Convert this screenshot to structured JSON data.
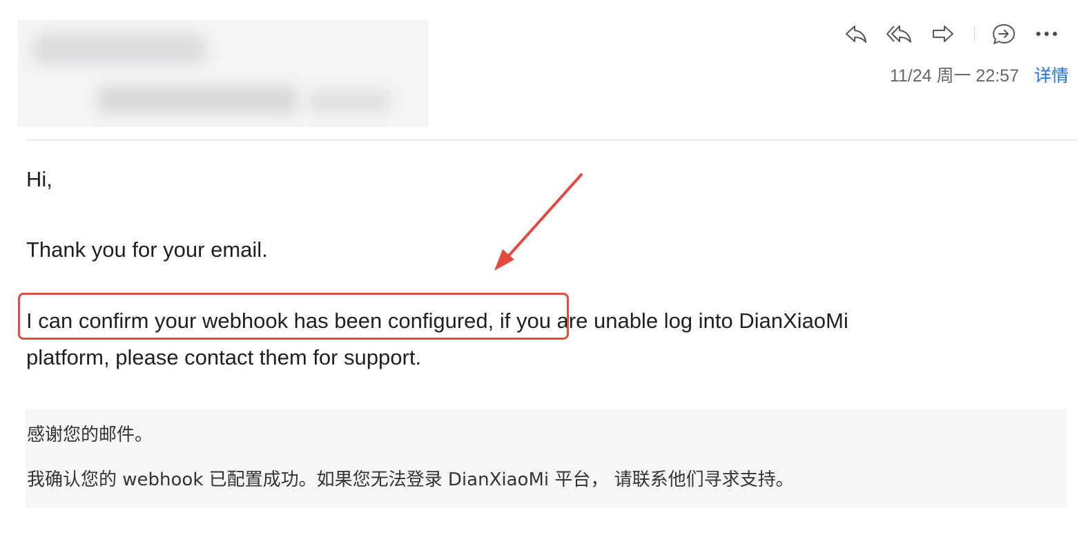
{
  "header": {
    "timestamp": "11/24 周一 22:57",
    "details_link": "详情",
    "actions": [
      {
        "name": "reply",
        "icon": "reply-icon"
      },
      {
        "name": "reply-all",
        "icon": "reply-all-icon"
      },
      {
        "name": "forward",
        "icon": "forward-icon"
      },
      {
        "name": "chat",
        "icon": "chat-reply-icon"
      },
      {
        "name": "more",
        "icon": "more-icon"
      }
    ]
  },
  "message": {
    "greeting": "Hi,",
    "thanks": "Thank you for your email.",
    "confirm_highlighted": "I can confirm your webhook has been configured,",
    "confirm_rest": " if you are unable log into DianXiaoMi",
    "platform_line": "platform, please contact them for support."
  },
  "translation": {
    "line1": "感谢您的邮件。",
    "line2": "我确认您的 webhook 已配置成功。如果您无法登录 DianXiaoMi 平台， 请联系他们寻求支持。"
  },
  "colors": {
    "annotation": "#e34a3f",
    "link": "#1a73e8",
    "translation_bg": "#f5f6f8"
  }
}
